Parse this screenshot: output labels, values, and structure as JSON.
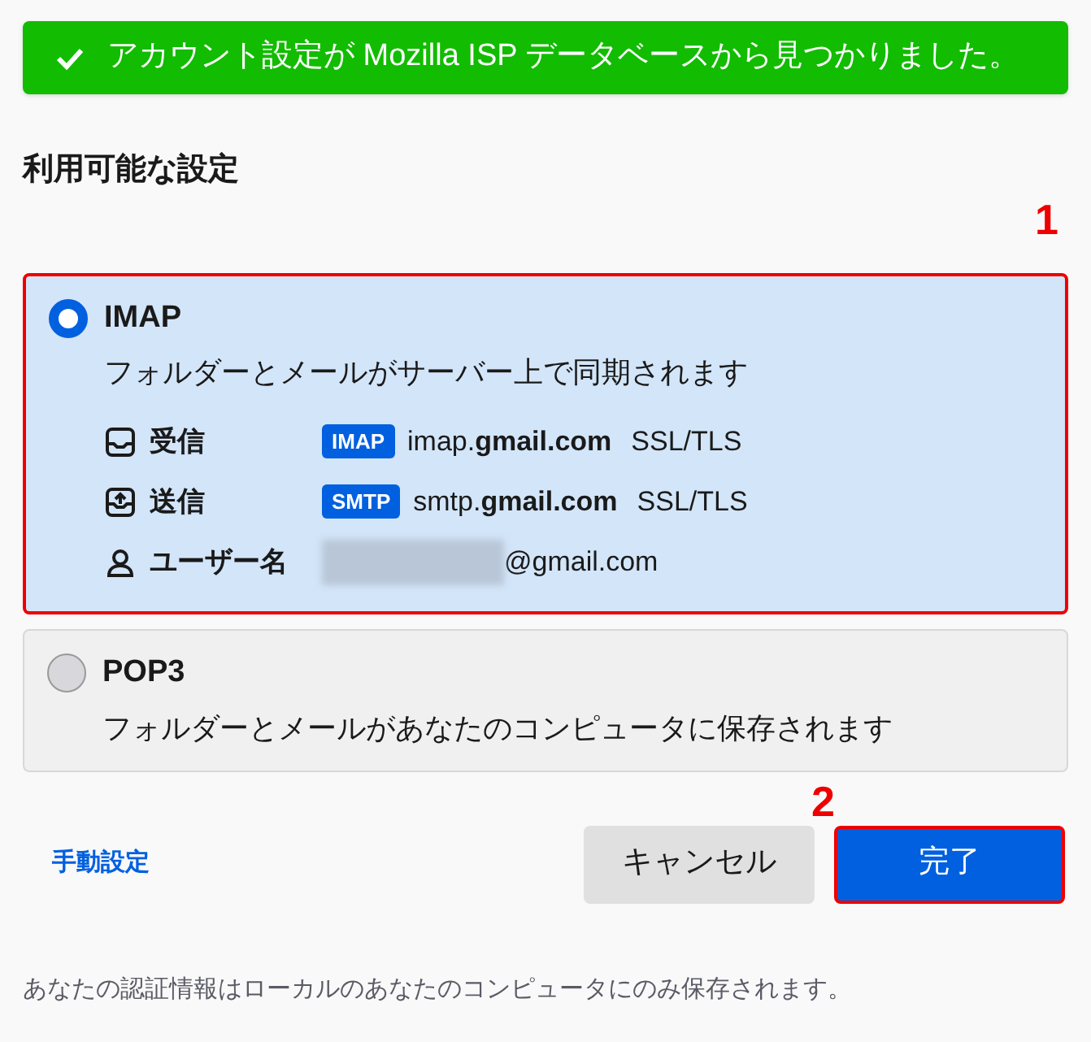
{
  "banner": {
    "text": "アカウント設定が Mozilla ISP データベースから見つかりました。"
  },
  "heading": "利用可能な設定",
  "options": [
    {
      "title": "IMAP",
      "description": "フォルダーとメールがサーバー上で同期されます",
      "selected": true,
      "highlighted": true,
      "marker": "1",
      "details": [
        {
          "kind": "incoming",
          "label": "受信",
          "badge": "IMAP",
          "host": "imap.**gmail.com**",
          "security": "SSL/TLS"
        },
        {
          "kind": "outgoing",
          "label": "送信",
          "badge": "SMTP",
          "host": "smtp.**gmail.com**",
          "security": "SSL/TLS"
        },
        {
          "kind": "username",
          "label": "ユーザー名",
          "value": "@gmail.com"
        }
      ]
    },
    {
      "title": "POP3",
      "description": "フォルダーとメールがあなたのコンピュータに保存されます",
      "selected": false,
      "highlighted": false
    }
  ],
  "manual_link": "手動設定",
  "buttons": [
    {
      "kind": "secondary",
      "label": "キャンセル",
      "highlighted": false
    },
    {
      "kind": "primary",
      "label": "完了",
      "highlighted": true,
      "marker": "2"
    }
  ],
  "footer": "あなたの認証情報はローカルのあなたのコンピュータにのみ保存されます。"
}
